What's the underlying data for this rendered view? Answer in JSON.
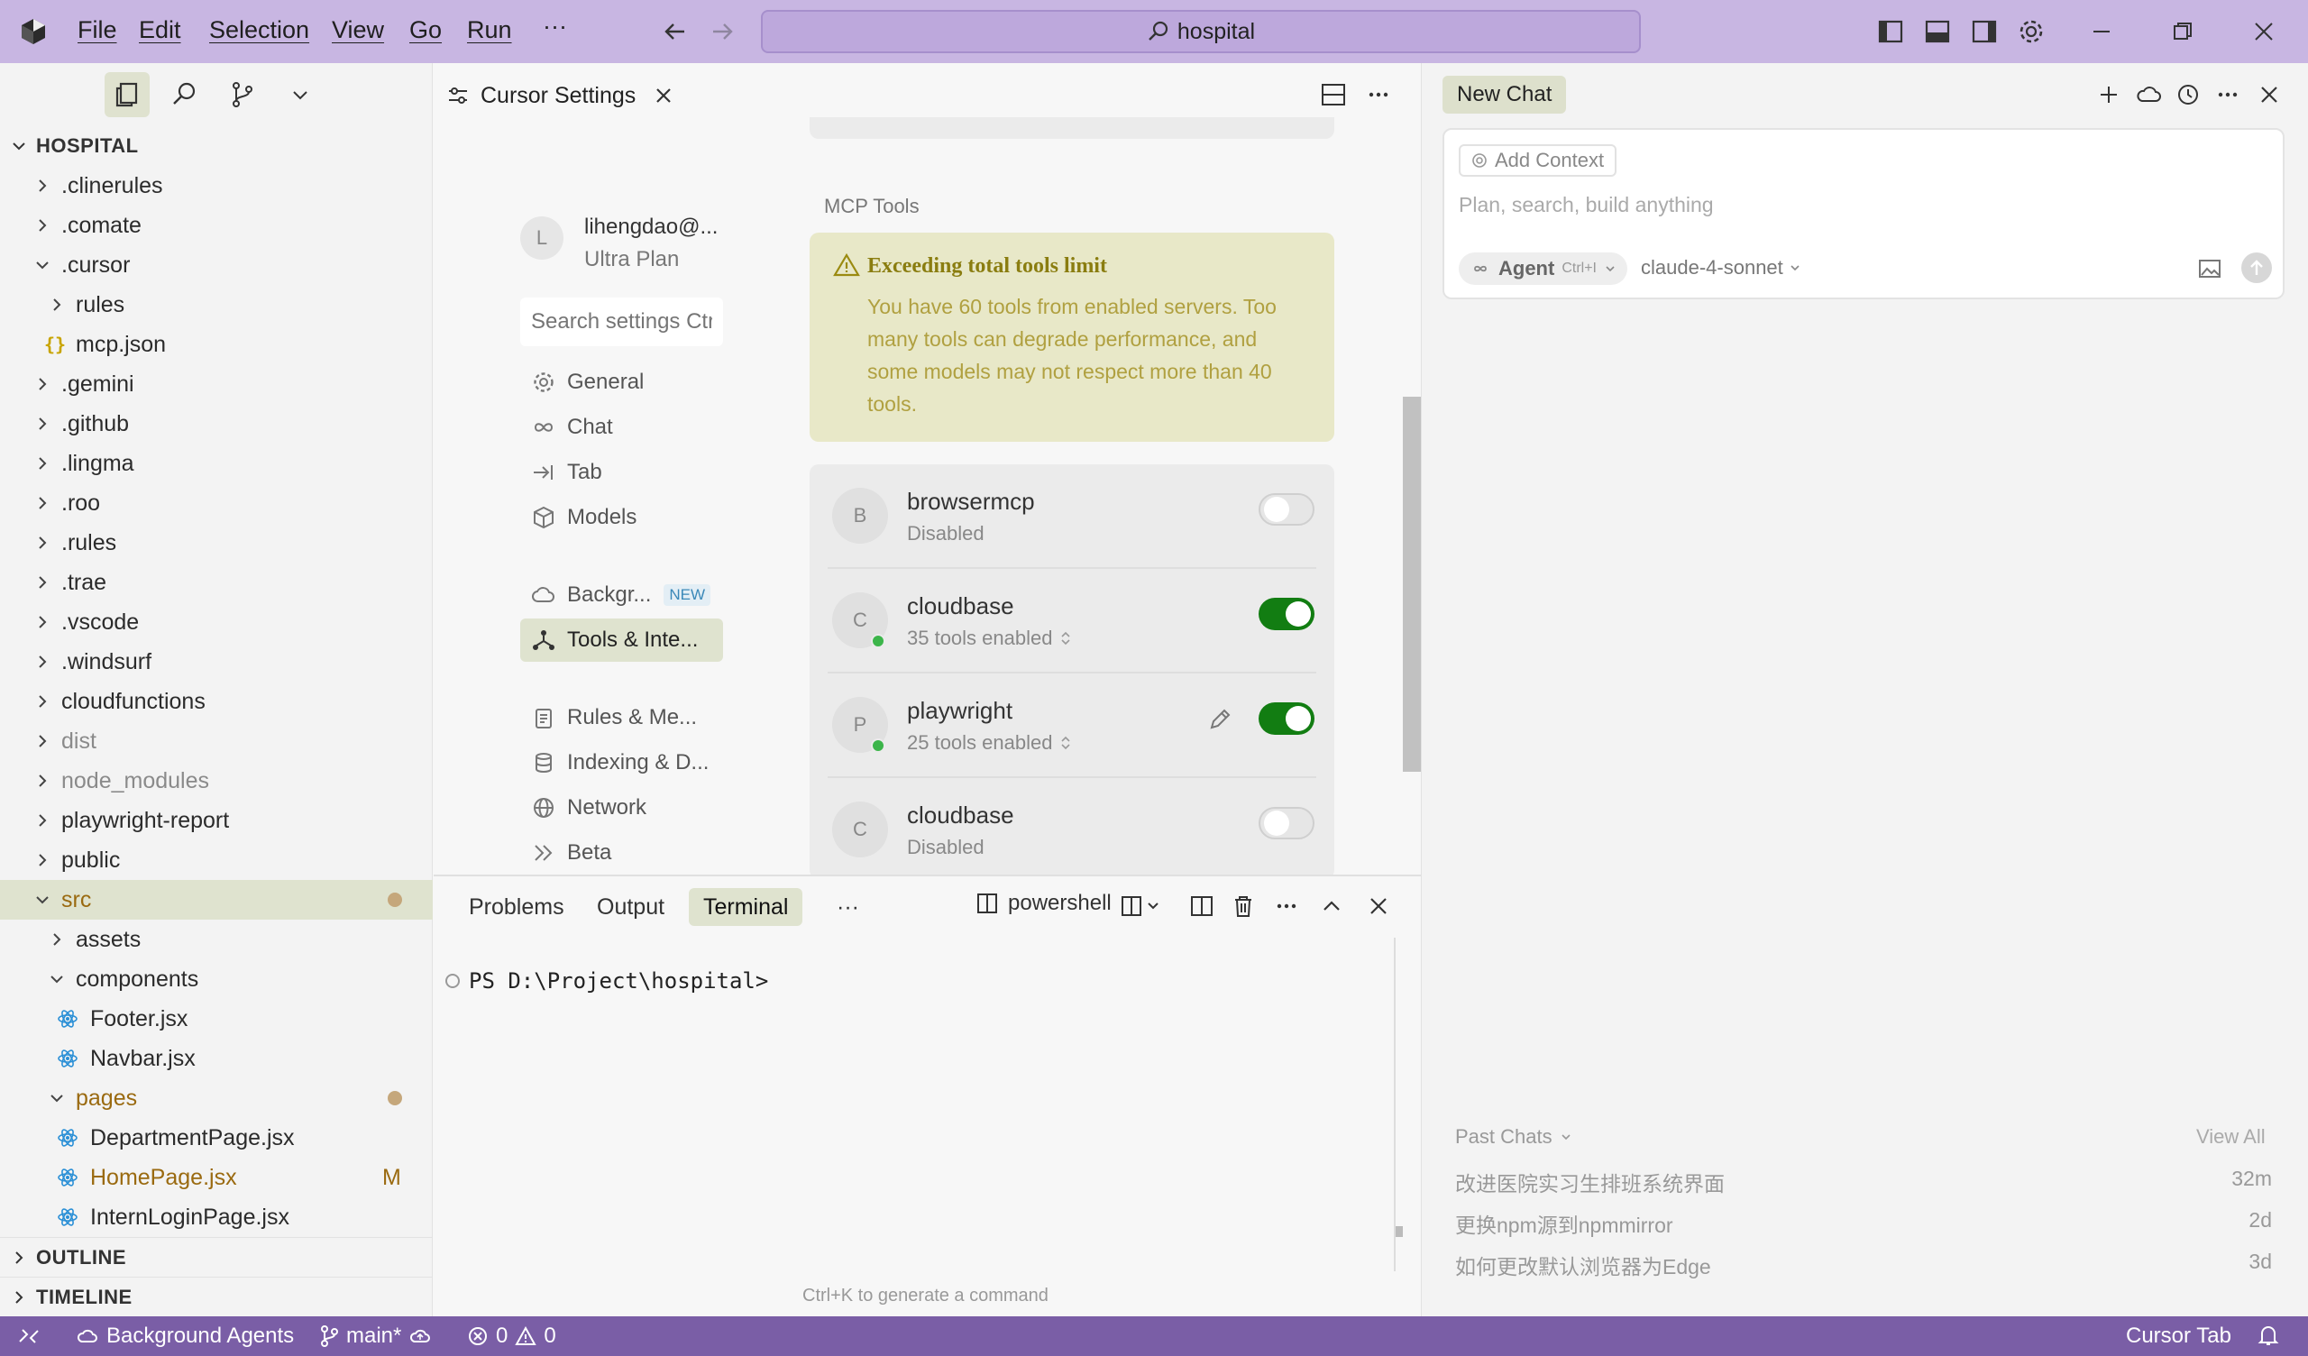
{
  "menu": [
    "File",
    "Edit",
    "Selection",
    "View",
    "Go",
    "Run",
    "···"
  ],
  "search": {
    "text": "hospital"
  },
  "explorer": {
    "root": "HOSPITAL",
    "items": [
      {
        "label": ".clinerules",
        "type": "folder",
        "depth": 1,
        "open": false
      },
      {
        "label": ".comate",
        "type": "folder",
        "depth": 1,
        "open": false
      },
      {
        "label": ".cursor",
        "type": "folder",
        "depth": 1,
        "open": true
      },
      {
        "label": "rules",
        "type": "folder",
        "depth": 2,
        "open": false
      },
      {
        "label": "mcp.json",
        "type": "json",
        "depth": 2
      },
      {
        "label": ".gemini",
        "type": "folder",
        "depth": 1,
        "open": false
      },
      {
        "label": ".github",
        "type": "folder",
        "depth": 1,
        "open": false
      },
      {
        "label": ".lingma",
        "type": "folder",
        "depth": 1,
        "open": false
      },
      {
        "label": ".roo",
        "type": "folder",
        "depth": 1,
        "open": false
      },
      {
        "label": ".rules",
        "type": "folder",
        "depth": 1,
        "open": false
      },
      {
        "label": ".trae",
        "type": "folder",
        "depth": 1,
        "open": false
      },
      {
        "label": ".vscode",
        "type": "folder",
        "depth": 1,
        "open": false
      },
      {
        "label": ".windsurf",
        "type": "folder",
        "depth": 1,
        "open": false
      },
      {
        "label": "cloudfunctions",
        "type": "folder",
        "depth": 1,
        "open": false
      },
      {
        "label": "dist",
        "type": "folder",
        "depth": 1,
        "open": false,
        "dim": true
      },
      {
        "label": "node_modules",
        "type": "folder",
        "depth": 1,
        "open": false,
        "dim": true
      },
      {
        "label": "playwright-report",
        "type": "folder",
        "depth": 1,
        "open": false
      },
      {
        "label": "public",
        "type": "folder",
        "depth": 1,
        "open": false
      },
      {
        "label": "src",
        "type": "folder",
        "depth": 1,
        "open": true,
        "selected": true,
        "modified": true
      },
      {
        "label": "assets",
        "type": "folder",
        "depth": 2,
        "open": false
      },
      {
        "label": "components",
        "type": "folder",
        "depth": 2,
        "open": true
      },
      {
        "label": "Footer.jsx",
        "type": "react",
        "depth": 3
      },
      {
        "label": "Navbar.jsx",
        "type": "react",
        "depth": 3
      },
      {
        "label": "pages",
        "type": "folder",
        "depth": 2,
        "open": true,
        "modified": true
      },
      {
        "label": "DepartmentPage.jsx",
        "type": "react",
        "depth": 3
      },
      {
        "label": "HomePage.jsx",
        "type": "react",
        "depth": 3,
        "badge": "M"
      },
      {
        "label": "InternLoginPage.jsx",
        "type": "react",
        "depth": 3
      }
    ],
    "outline": "OUTLINE",
    "timeline": "TIMELINE"
  },
  "editor_tab": {
    "title": "Cursor Settings"
  },
  "settings": {
    "user_initial": "L",
    "user_email": "lihengdao@...",
    "user_plan": "Ultra Plan",
    "search_placeholder": "Search settings Ctrl",
    "nav": [
      {
        "label": "General",
        "icon": "gear-icon"
      },
      {
        "label": "Chat",
        "icon": "infinity-icon"
      },
      {
        "label": "Tab",
        "icon": "tab-arrow-icon"
      },
      {
        "label": "Models",
        "icon": "cube-icon"
      },
      {
        "label": "Backgr...",
        "icon": "cloud-icon",
        "badge": "NEW"
      },
      {
        "label": "Tools & Inte...",
        "icon": "tools-icon",
        "active": true
      },
      {
        "label": "Rules & Me...",
        "icon": "clipboard-icon"
      },
      {
        "label": "Indexing & D...",
        "icon": "database-icon"
      },
      {
        "label": "Network",
        "icon": "globe-icon"
      },
      {
        "label": "Beta",
        "icon": "double-chevron-icon"
      }
    ],
    "mcp_title": "MCP Tools",
    "warning_title": "Exceeding total tools limit",
    "warning_lines": [
      "You have 60 tools from enabled servers. Too",
      "many tools can degrade performance, and",
      "some models may not respect more than 40",
      "tools."
    ],
    "servers": [
      {
        "initial": "B",
        "name": "browsermcp",
        "status": "Disabled",
        "enabled": false,
        "online": false,
        "expandable": false,
        "editable": false
      },
      {
        "initial": "C",
        "name": "cloudbase",
        "status": "35 tools enabled",
        "enabled": true,
        "online": true,
        "expandable": true,
        "editable": false
      },
      {
        "initial": "P",
        "name": "playwright",
        "status": "25 tools enabled",
        "enabled": true,
        "online": true,
        "expandable": true,
        "editable": true
      },
      {
        "initial": "C",
        "name": "cloudbase",
        "status": "Disabled",
        "enabled": false,
        "online": false,
        "expandable": false,
        "editable": false
      }
    ]
  },
  "panel": {
    "tabs": [
      "Problems",
      "Output",
      "Terminal"
    ],
    "more": "···",
    "shell": "powershell",
    "prompt": "PS D:\\Project\\hospital>",
    "hint": "Ctrl+K to generate a command"
  },
  "chat": {
    "tab": "New Chat",
    "add_context": "Add Context",
    "placeholder": "Plan, search, build anything",
    "agent_label": "Agent",
    "agent_shortcut": "Ctrl+I",
    "model": "claude-4-sonnet",
    "past_title": "Past Chats",
    "view_all": "View All",
    "past": [
      {
        "title": "改进医院实习生排班系统界面",
        "time": "32m"
      },
      {
        "title": "更换npm源到npmmirror",
        "time": "2d"
      },
      {
        "title": "如何更改默认浏览器为Edge",
        "time": "3d"
      }
    ]
  },
  "status": {
    "background_agents": "Background Agents",
    "branch": "main*",
    "errors": "0",
    "warnings": "0",
    "cursor_tab": "Cursor Tab"
  },
  "colors": {
    "titlebar": "#c8b6e2",
    "statusbar": "#7a5ea6",
    "toggle_on": "#127d12",
    "warning_bg": "#e8e8c8",
    "selection": "#dfe3cf"
  }
}
